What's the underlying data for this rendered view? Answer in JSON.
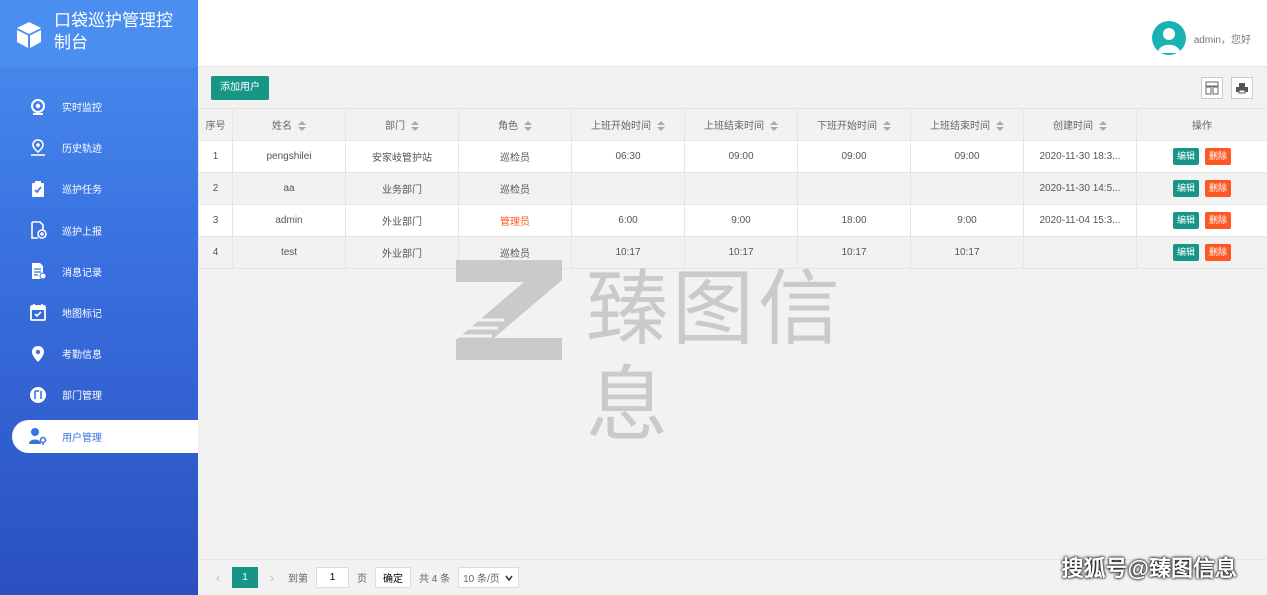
{
  "app": {
    "title": "口袋巡护管理控制台"
  },
  "sidebar": {
    "items": [
      {
        "label": "实时监控",
        "icon": "webcam-icon"
      },
      {
        "label": "历史轨迹",
        "icon": "location-track-icon"
      },
      {
        "label": "巡护任务",
        "icon": "clipboard-check-icon"
      },
      {
        "label": "巡护上报",
        "icon": "report-upload-icon"
      },
      {
        "label": "消息记录",
        "icon": "message-record-icon"
      },
      {
        "label": "地图标记",
        "icon": "calendar-check-icon"
      },
      {
        "label": "考勤信息",
        "icon": "map-pin-icon"
      },
      {
        "label": "部门管理",
        "icon": "department-icon"
      },
      {
        "label": "用户管理",
        "icon": "user-key-icon"
      }
    ],
    "active_index": 8
  },
  "header": {
    "greeting": "admin，您好"
  },
  "toolbar": {
    "add_label": "添加用户"
  },
  "table": {
    "columns": [
      "序号",
      "姓名",
      "部门",
      "角色",
      "上班开始时间",
      "上班结束时间",
      "下班开始时间",
      "上班结束时间",
      "创建时间",
      "操作"
    ],
    "rows": [
      {
        "no": "1",
        "name": "pengshilei",
        "dept": "安家岐管护站",
        "role": "巡检员",
        "t1": "06:30",
        "t2": "09:00",
        "t3": "09:00",
        "t4": "09:00",
        "created": "2020-11-30 18:3..."
      },
      {
        "no": "2",
        "name": "aa",
        "dept": "业务部门",
        "role": "巡检员",
        "t1": "",
        "t2": "",
        "t3": "",
        "t4": "",
        "created": "2020-11-30 14:5..."
      },
      {
        "no": "3",
        "name": "admin",
        "dept": "外业部门",
        "role": "管理员",
        "t1": "6:00",
        "t2": "9:00",
        "t3": "18:00",
        "t4": "9:00",
        "created": "2020-11-04 15:3..."
      },
      {
        "no": "4",
        "name": "test",
        "dept": "外业部门",
        "role": "巡检员",
        "t1": "10:17",
        "t2": "10:17",
        "t3": "10:17",
        "t4": "10:17",
        "created": ""
      }
    ],
    "edit_label": "编辑",
    "delete_label": "删除"
  },
  "watermark": {
    "text": "臻图信息"
  },
  "pager": {
    "current": "1",
    "goto_label": "到第",
    "page_value": "1",
    "page_unit": "页",
    "confirm_label": "确定",
    "total_label": "共 4 条",
    "size_label": "10 条/页"
  },
  "corner_watermark": "搜狐号@臻图信息",
  "colors": {
    "accent": "#179688",
    "danger": "#ff5722",
    "sidebar": "#3a72e0"
  }
}
